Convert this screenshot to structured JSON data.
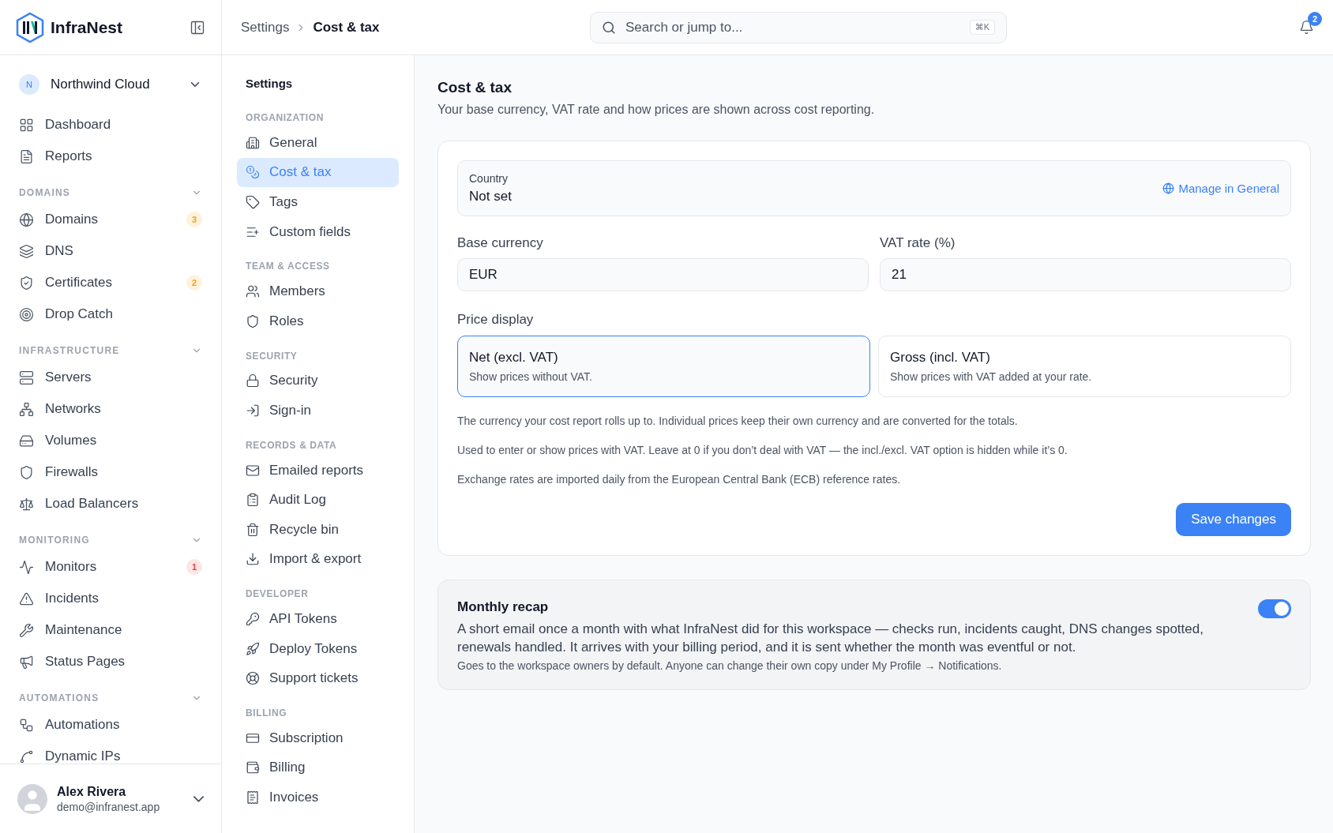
{
  "brand": {
    "name": "InfraNest"
  },
  "workspace": {
    "initial": "N",
    "name": "Northwind Cloud"
  },
  "nav": [
    {
      "items": [
        {
          "label": "Dashboard"
        },
        {
          "label": "Reports"
        }
      ]
    },
    {
      "heading": "DOMAINS",
      "items": [
        {
          "label": "Domains",
          "badge": "3",
          "color": "#f59e0b"
        },
        {
          "label": "DNS"
        },
        {
          "label": "Certificates",
          "badge": "2",
          "color": "#f59e0b"
        },
        {
          "label": "Drop Catch"
        }
      ]
    },
    {
      "heading": "INFRASTRUCTURE",
      "items": [
        {
          "label": "Servers"
        },
        {
          "label": "Networks"
        },
        {
          "label": "Volumes"
        },
        {
          "label": "Firewalls"
        },
        {
          "label": "Load Balancers"
        }
      ]
    },
    {
      "heading": "MONITORING",
      "items": [
        {
          "label": "Monitors",
          "badge": "1",
          "color": "#ef4444"
        },
        {
          "label": "Incidents"
        },
        {
          "label": "Maintenance"
        },
        {
          "label": "Status Pages"
        }
      ]
    },
    {
      "heading": "AUTOMATIONS",
      "items": [
        {
          "label": "Automations"
        },
        {
          "label": "Dynamic IPs"
        }
      ]
    }
  ],
  "user": {
    "name": "Alex Rivera",
    "email": "demo@infranest.app"
  },
  "breadcrumb": [
    "Settings",
    "Cost & tax"
  ],
  "search": {
    "placeholder": "Search or jump to...",
    "shortcut": "⌘K"
  },
  "notifications": {
    "count": "2"
  },
  "settings_nav": {
    "title": "Settings",
    "groups": [
      {
        "heading": "ORGANIZATION",
        "items": [
          {
            "label": "General",
            "selected": false
          },
          {
            "label": "Cost & tax",
            "selected": true
          },
          {
            "label": "Tags",
            "selected": false
          },
          {
            "label": "Custom fields",
            "selected": false
          }
        ]
      },
      {
        "heading": "TEAM & ACCESS",
        "items": [
          {
            "label": "Members",
            "selected": false
          },
          {
            "label": "Roles",
            "selected": false
          }
        ]
      },
      {
        "heading": "SECURITY",
        "items": [
          {
            "label": "Security",
            "selected": false
          },
          {
            "label": "Sign-in",
            "selected": false
          }
        ]
      },
      {
        "heading": "RECORDS & DATA",
        "items": [
          {
            "label": "Emailed reports",
            "selected": false
          },
          {
            "label": "Audit Log",
            "selected": false
          },
          {
            "label": "Recycle bin",
            "selected": false
          },
          {
            "label": "Import & export",
            "selected": false
          }
        ]
      },
      {
        "heading": "DEVELOPER",
        "items": [
          {
            "label": "API Tokens",
            "selected": false
          },
          {
            "label": "Deploy Tokens",
            "selected": false
          },
          {
            "label": "Support tickets",
            "selected": false
          }
        ]
      },
      {
        "heading": "BILLING",
        "items": [
          {
            "label": "Subscription",
            "selected": false
          },
          {
            "label": "Billing",
            "selected": false
          },
          {
            "label": "Invoices",
            "selected": false
          }
        ]
      }
    ]
  },
  "page": {
    "title": "Cost & tax",
    "subtitle": "Your base currency, VAT rate and how prices are shown across cost reporting."
  },
  "country": {
    "label": "Country",
    "value": "Not set",
    "link": "Manage in General"
  },
  "fields": [
    {
      "label": "Base currency",
      "value": "EUR"
    },
    {
      "label": "VAT rate (%)",
      "value": "21"
    }
  ],
  "price_display": {
    "label": "Price display",
    "options": [
      {
        "title": "Net (excl. VAT)",
        "description": "Show prices without VAT.",
        "selected": true
      },
      {
        "title": "Gross (incl. VAT)",
        "description": "Show prices with VAT added at your rate.",
        "selected": false
      }
    ]
  },
  "notes": [
    "The currency your cost report rolls up to. Individual prices keep their own currency and are converted for the totals.",
    "Used to enter or show prices with VAT. Leave at 0 if you don’t deal with VAT — the incl./excl. VAT option is hidden while it’s 0.",
    "Exchange rates are imported daily from the European Central Bank (ECB) reference rates."
  ],
  "save_button": "Save changes",
  "recap": {
    "title": "Monthly recap",
    "on": true,
    "description": "A short email once a month with what InfraNest did for this workspace — checks run, incidents caught, DNS changes spotted, renewals handled. It arrives with your billing period, and it is sent whether the month was eventful or not.",
    "note": "Goes to the workspace owners by default. Anyone can change their own copy under My Profile → Notifications."
  }
}
